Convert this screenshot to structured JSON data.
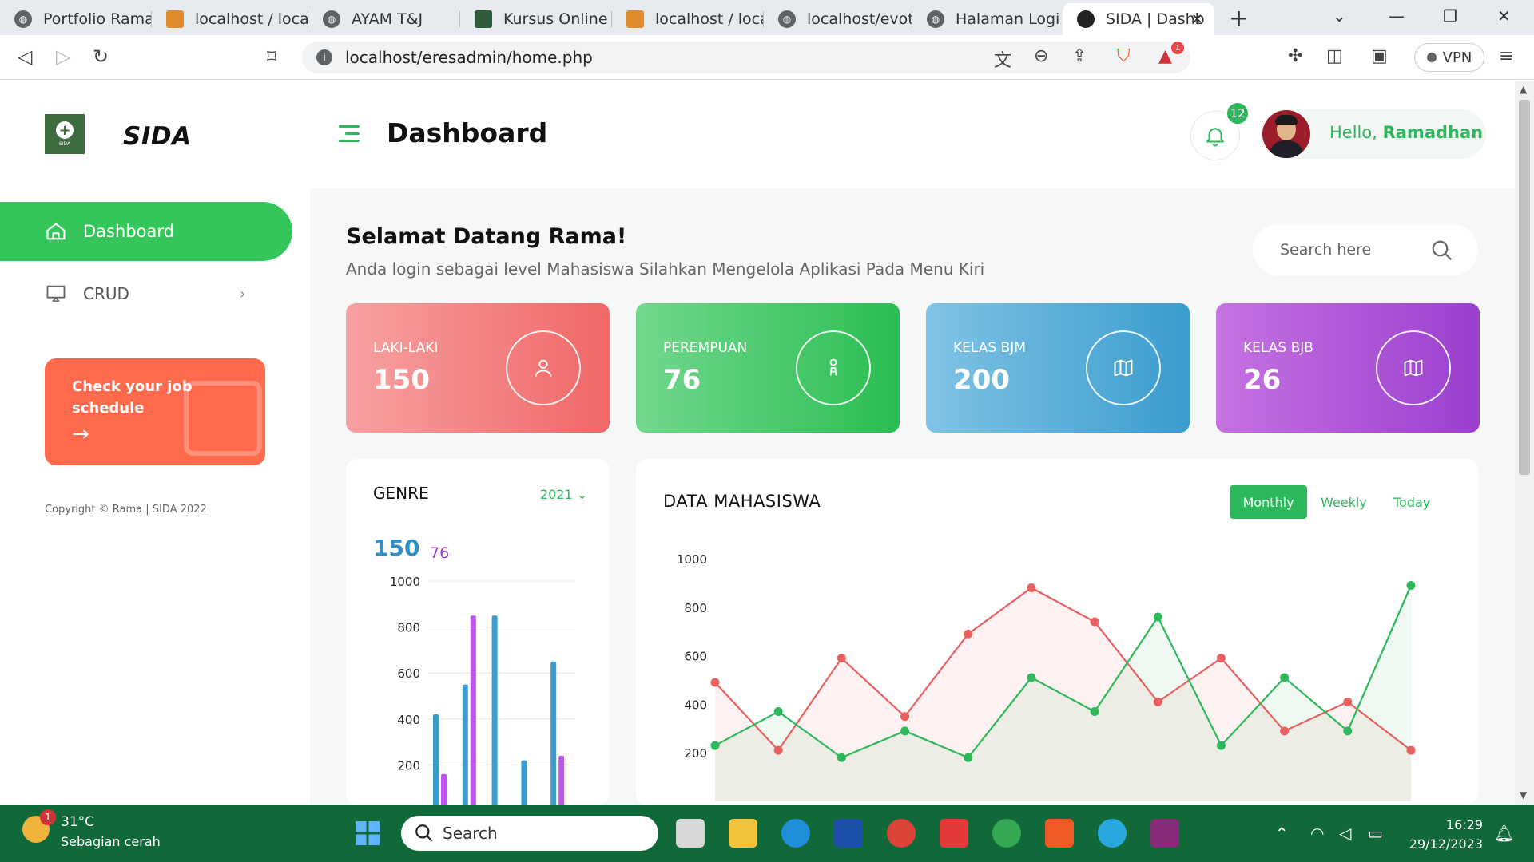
{
  "browser": {
    "tabs": [
      {
        "label": "Portfolio Ramadh",
        "icon": "globe-icon"
      },
      {
        "label": "localhost / localh",
        "icon": "phpmyadmin-icon"
      },
      {
        "label": "AYAM T&J",
        "icon": "globe-icon"
      },
      {
        "label": "Kursus Online",
        "icon": "graduation-icon"
      },
      {
        "label": "localhost / localh",
        "icon": "phpmyadmin-icon"
      },
      {
        "label": "localhost/evotin",
        "icon": "globe-icon"
      },
      {
        "label": "Halaman Login",
        "icon": "globe-icon"
      },
      {
        "label": "SIDA | Dashb",
        "icon": "user-icon",
        "active": true
      }
    ],
    "url": "localhost/eresadmin/home.php",
    "vpn_label": "VPN",
    "alert_badge": "1"
  },
  "app": {
    "brand": "SIDA",
    "logo_text": "SIDA",
    "page_title": "Dashboard",
    "notification_count": "12",
    "greeting_prefix": "Hello,",
    "user_name": "Ramadhan"
  },
  "sidebar": {
    "items": [
      {
        "label": "Dashboard",
        "icon": "home-icon",
        "active": true
      },
      {
        "label": "CRUD",
        "icon": "monitor-icon",
        "active": false
      }
    ],
    "job_card": {
      "text": "Check your job schedule",
      "arrow": "→"
    },
    "copyright": "Copyright © Rama | SIDA 2022"
  },
  "main": {
    "welcome_title": "Selamat Datang Rama!",
    "welcome_sub": "Anda login sebagai level Mahasiswa Silahkan Mengelola Aplikasi Pada Menu Kiri",
    "search_placeholder": "Search here",
    "stats": [
      {
        "label": "LAKI-LAKI",
        "value": "150",
        "icon": "user-icon",
        "color_from": "#f7a1a1",
        "color_to": "#f06767"
      },
      {
        "label": "PEREMPUAN",
        "value": "76",
        "icon": "female-icon",
        "color_from": "#6fd68a",
        "color_to": "#2bbd52"
      },
      {
        "label": "KELAS BJM",
        "value": "200",
        "icon": "map-icon",
        "color_from": "#7dc0e3",
        "color_to": "#3a9ccf"
      },
      {
        "label": "KELAS BJB",
        "value": "26",
        "icon": "map-icon",
        "color_from": "#c36ee0",
        "color_to": "#9a3fcf"
      }
    ],
    "genre": {
      "title": "GENRE",
      "year": "2021",
      "value_a": "150",
      "value_b": "76"
    },
    "data_mahasiswa": {
      "title": "DATA MAHASISWA",
      "tabs": [
        "Monthly",
        "Weekly",
        "Today"
      ]
    }
  },
  "chart_data": [
    {
      "type": "bar",
      "title": "GENRE",
      "ylim": [
        0,
        1000
      ],
      "yticks": [
        200,
        400,
        600,
        800,
        1000
      ],
      "series": [
        {
          "color": "#3a9ccf",
          "values": [
            420,
            550,
            850,
            220,
            650
          ]
        },
        {
          "color": "#c154f0",
          "values": [
            160,
            850,
            null,
            null,
            240
          ]
        }
      ],
      "grid": true
    },
    {
      "type": "area",
      "title": "DATA MAHASISWA",
      "ylim": [
        0,
        1000
      ],
      "yticks": [
        200,
        400,
        600,
        800,
        1000
      ],
      "series": [
        {
          "color": "#e8605f",
          "values": [
            490,
            210,
            590,
            350,
            690,
            880,
            740,
            410,
            590,
            290,
            410,
            210
          ]
        },
        {
          "color": "#2eb85c",
          "values": [
            230,
            370,
            180,
            290,
            180,
            510,
            370,
            760,
            230,
            510,
            290,
            890
          ]
        }
      ],
      "grid": false
    }
  ],
  "taskbar": {
    "temperature": "31°C",
    "condition": "Sebagian cerah",
    "weather_badge": "1",
    "search_label": "Search",
    "time": "16:29",
    "date": "29/12/2023"
  }
}
